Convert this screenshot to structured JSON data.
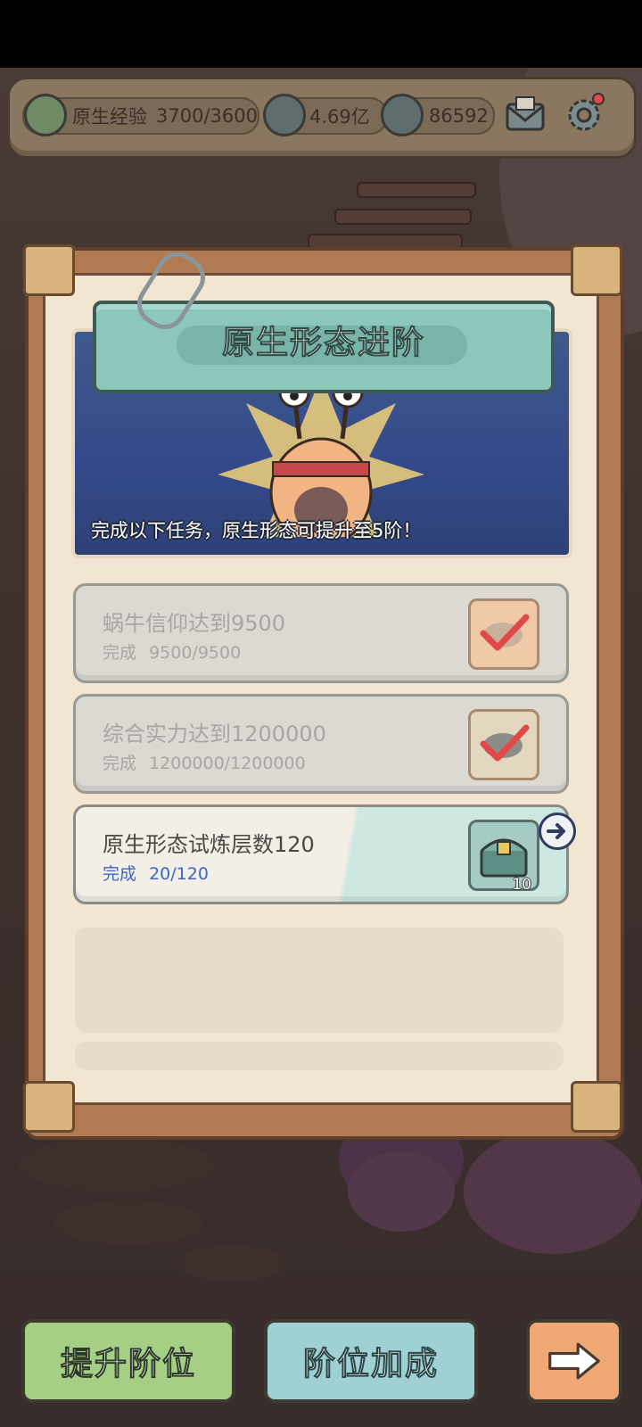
{
  "topbar": {
    "exp_label": "原生经验",
    "exp_value": "3700/3600",
    "currency1_value": "4.69亿",
    "currency2_value": "86592",
    "icons": [
      "eye-badge-icon",
      "speech-bubble-icon",
      "speech-bubble-icon",
      "mail-icon",
      "gear-icon"
    ],
    "gear_has_badge": true
  },
  "panel": {
    "title": "原生形态进阶",
    "banner_text": "完成以下任务，原生形态可提升至5阶！"
  },
  "tasks": [
    {
      "title": "蜗牛信仰达到9500",
      "progress_label": "完成",
      "progress_value": "9500/9500",
      "status": "completed",
      "reward_icon": "fish-check-icon"
    },
    {
      "title": "综合实力达到1200000",
      "progress_label": "完成",
      "progress_value": "1200000/1200000",
      "status": "completed",
      "reward_icon": "fish-check-icon"
    },
    {
      "title": "原生形态试炼层数120",
      "progress_label": "完成",
      "progress_value": "20/120",
      "status": "in_progress",
      "reward_icon": "treasure-chest-icon",
      "reward_count": "10"
    }
  ],
  "buttons": {
    "upgrade": "提升阶位",
    "bonus": "阶位加成",
    "next_icon": "arrow-right-icon"
  },
  "colors": {
    "panel_bg": "#f2e6d3",
    "title_teal": "#8cc7bc",
    "progress_blue": "#3a67c8",
    "upgrade_green": "#a5cf84",
    "bonus_teal": "#9fd0d4",
    "next_orange": "#f0a877"
  }
}
